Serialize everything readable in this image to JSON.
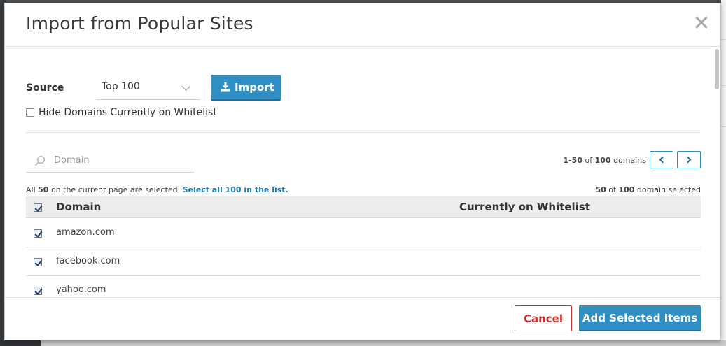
{
  "modal": {
    "title": "Import from Popular Sites",
    "close_symbol": "✕"
  },
  "source": {
    "label": "Source",
    "selected": "Top 100",
    "import_label": "Import"
  },
  "hide_filter": {
    "label": "Hide Domains Currently on Whitelist",
    "checked": false
  },
  "search": {
    "placeholder": "Domain",
    "value": ""
  },
  "pagination": {
    "range": "1-50",
    "of": "of",
    "total": "100",
    "unit": "domains"
  },
  "selection": {
    "prefix": "All",
    "count": "50",
    "suffix": "on the current page are selected.",
    "select_all_link": "Select all 100 in the list.",
    "summary_count": "50",
    "summary_of": "of",
    "summary_total": "100",
    "summary_unit": "domain selected"
  },
  "table": {
    "columns": [
      "Domain",
      "Currently on Whitelist"
    ],
    "rows": [
      {
        "domain": "amazon.com",
        "whitelist": "",
        "checked": true
      },
      {
        "domain": "facebook.com",
        "whitelist": "",
        "checked": true
      },
      {
        "domain": "yahoo.com",
        "whitelist": "",
        "checked": true
      }
    ]
  },
  "footer": {
    "cancel_label": "Cancel",
    "add_label": "Add Selected Items"
  },
  "colors": {
    "primary": "#2f8fc5",
    "danger": "#c9302c",
    "link": "#1e7db8"
  }
}
